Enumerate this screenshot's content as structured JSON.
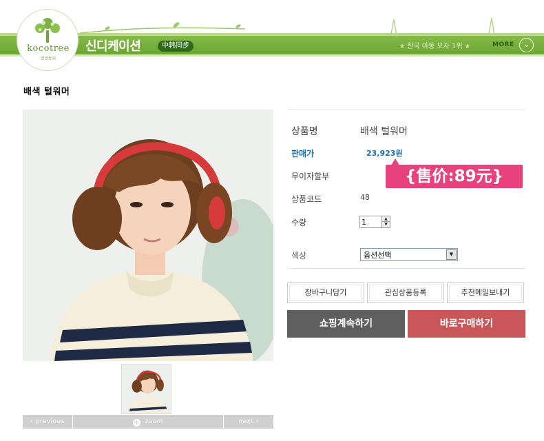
{
  "header": {
    "logo_text": "kocotree",
    "logo_sub": "코코트리",
    "shop_name": "신디케이션",
    "shop_tag": "中韩同步",
    "slogan_star_left": "★",
    "slogan": "한국 아동 모자 1위",
    "slogan_star_right": "★",
    "more_label": "MORE",
    "more_icon": "⌄"
  },
  "product": {
    "title": "배색 털워머",
    "nav": {
      "previous": "previous",
      "zoom": "zoom",
      "zoom_icon": "+",
      "next": "next",
      "prev_arrow": "‹",
      "next_arrow": "›"
    },
    "info": {
      "name_label": "상품명",
      "name_value": "배색 털워머",
      "price_label": "판매가",
      "price_value": "23,923원",
      "promo": "{售价:89元}",
      "interest_label": "무이자할부",
      "code_label": "상품코드",
      "code_value": "48",
      "qty_label": "수량",
      "qty_value": "1",
      "color_label": "색상",
      "color_select": "옵션선택"
    },
    "buttons": {
      "cart": "장바구니담기",
      "wishlist": "관심상품등록",
      "recommend": "추천메일보내기",
      "continue": "쇼핑계속하기",
      "buy_now": "바로구매하기"
    }
  },
  "colors": {
    "brand_green": "#7ab03c",
    "price_blue": "#1a6fb0",
    "promo_pink": "#e8427c",
    "buy_red": "#c95658",
    "continue_gray": "#5f5f5f"
  }
}
